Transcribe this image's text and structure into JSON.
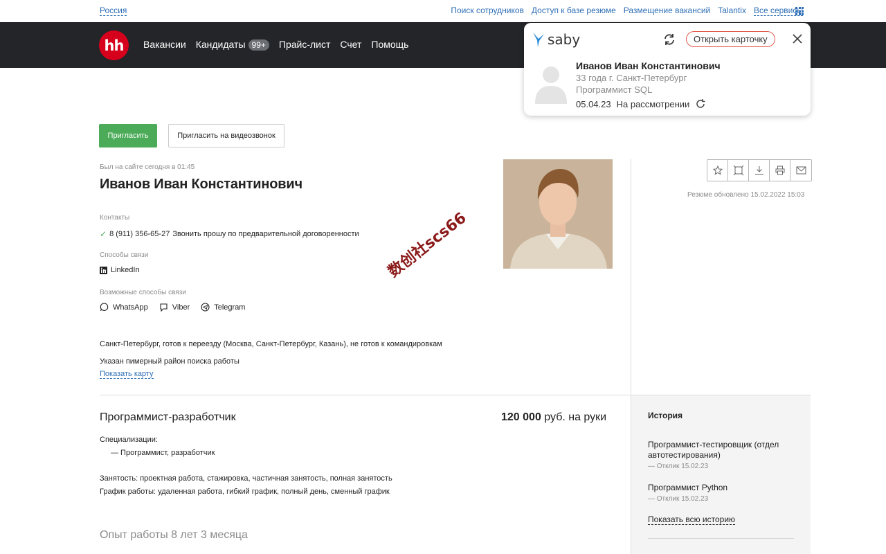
{
  "topbar": {
    "region": "Россия",
    "links": [
      "Поиск сотрудников",
      "Доступ к базе резюме",
      "Размещение вакансий",
      "Talantix"
    ],
    "all_services": "Все сервисы"
  },
  "navbar": {
    "logo": "hh",
    "items": [
      {
        "label": "Вакансии"
      },
      {
        "label": "Кандидаты",
        "badge": "99+"
      },
      {
        "label": "Прайс-лист"
      },
      {
        "label": "Счет"
      },
      {
        "label": "Помощь"
      }
    ]
  },
  "saby": {
    "brand": "saby",
    "open_card": "Открыть карточку",
    "name": "Иванов Иван Константинович",
    "age_city": "33 года  г. Санкт-Петербург",
    "position": "Программист SQL",
    "date": "05.04.23",
    "status": "На рассмотрении"
  },
  "actions": {
    "invite": "Пригласить",
    "invite_video": "Пригласить на видеозвонок"
  },
  "resume": {
    "last_seen": "Был на сайте сегодня в 01:45",
    "name": "Иванов Иван Константинович",
    "contacts_label": "Контакты",
    "phone": "8 (911) 356-65-27",
    "phone_note": "Звонить прошу по предварительной договоренности",
    "contact_methods_label": "Способы связи",
    "linkedin": "LinkedIn",
    "possible_methods_label": "Возможные способы связи",
    "messengers": [
      "WhatsApp",
      "Viber",
      "Telegram"
    ],
    "location": "Санкт-Петербург, готов к переезду (Москва, Санкт-Петербург, Казань), не готов к командировкам",
    "area_note": "Указан пимерный район поиска работы",
    "show_map": "Показать карту",
    "updated": "Резюме обновлено 15.02.2022 15:03"
  },
  "job": {
    "title": "Программист-разработчик",
    "salary_amount": "120 000",
    "salary_suffix": "руб. на руки",
    "spec_label": "Специализации:",
    "spec_item": "— Программист, разработчик",
    "employment": "Занятость: проектная работа, стажировка, частичная занятость, полная занятость",
    "schedule": "График работы: удаленная работа, гибкий график, полный день, сменный график",
    "experience": "Опыт работы 8 лет 3 месяца"
  },
  "history": {
    "title": "История",
    "items": [
      {
        "title": "Программист-тестировщик (отдел автотестирования)",
        "sub": "— Отклик 15.02.23"
      },
      {
        "title": "Программист Python",
        "sub": "— Отклик 15.02.23"
      }
    ],
    "show_all": "Показать всю историю"
  },
  "watermark": "数创社scs66",
  "colors": {
    "link": "#2e6fb6",
    "navbar": "#232529",
    "brand_red": "#d6001c",
    "invite_green": "#4bab58",
    "saby_blue": "#2b8bd9"
  }
}
